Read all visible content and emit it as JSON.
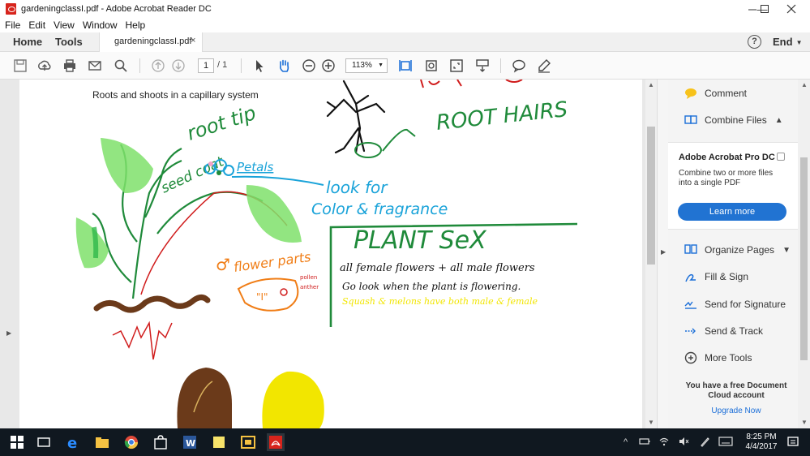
{
  "window": {
    "title": "gardeningclassI.pdf - Adobe Acrobat Reader DC",
    "minimize": "—",
    "maximize": "☐",
    "close": "✕"
  },
  "menu": [
    "File",
    "Edit",
    "View",
    "Window",
    "Help"
  ],
  "tabs": {
    "home": "Home",
    "tools": "Tools",
    "document": "gardeningclassI.pdf",
    "document_close": "×",
    "help": "?",
    "user": "End"
  },
  "toolbar": {
    "page_current": "1",
    "page_total": "/ 1",
    "zoom": "113%"
  },
  "document": {
    "caption": "Roots and shoots in a capillary system",
    "handwriting": {
      "root_tip": "root tip",
      "root_hairs": "ROOT HAIRS",
      "seed_coat": "seed coat",
      "petals": "Petals",
      "look_for": "look for",
      "color_fragrance": "Color & fragrance",
      "plant_sex": "PLANT SeX",
      "female_male": "all female flowers + all male flowers",
      "go_look": "Go look when the plant is flowering.",
      "squash": "Squash & melons have both male & female",
      "flower_parts": "flower parts",
      "pollen": "pollen",
      "anther": "anther"
    }
  },
  "right_pane": {
    "comment": "Comment",
    "combine_files": "Combine Files",
    "promo_title": "Adobe Acrobat Pro DC",
    "promo_copy": "Combine two or more files into a single PDF",
    "learn_more": "Learn more",
    "organize_pages": "Organize Pages",
    "fill_sign": "Fill & Sign",
    "send_signature": "Send for Signature",
    "send_track": "Send & Track",
    "more_tools": "More Tools",
    "free_info": "You have a free Document Cloud account",
    "upgrade": "Upgrade Now"
  },
  "taskbar": {
    "time": "8:25 PM",
    "date": "4/4/2017"
  },
  "colors": {
    "accent_blue": "#2173d2",
    "ink_green": "#1f8a3a",
    "ink_blue": "#1aa3d9",
    "ink_orange": "#f07d16",
    "ink_yellow": "#f2e600",
    "ink_brown": "#6b3a1a",
    "ink_red": "#d01c1c"
  }
}
